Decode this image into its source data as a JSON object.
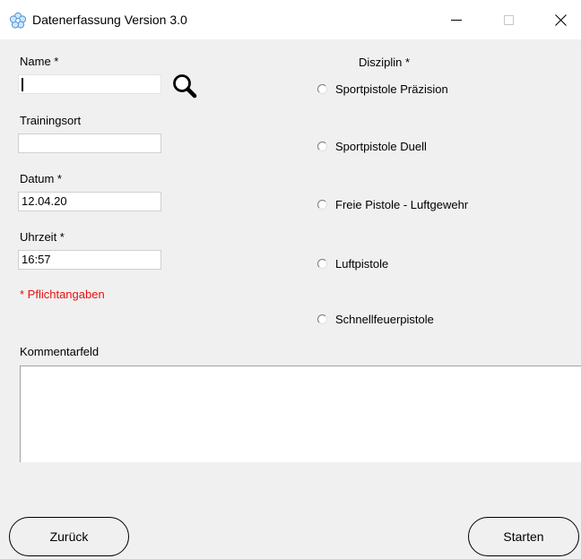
{
  "window": {
    "title": "Datenerfassung Version 3.0",
    "icon": "app-flower-icon",
    "controls": {
      "minimize": "minimize-icon",
      "maximize": "maximize-icon",
      "close": "close-icon"
    }
  },
  "form": {
    "name_label": "Name *",
    "name_value": "",
    "search_icon": "search-icon",
    "trainingsort_label": "Trainingsort",
    "trainingsort_value": "",
    "datum_label": "Datum *",
    "datum_value": "12.04.20",
    "uhrzeit_label": "Uhrzeit *",
    "uhrzeit_value": "16:57",
    "required_note": "* Pflichtangaben"
  },
  "disziplin": {
    "label": "Disziplin *",
    "options": [
      {
        "label": "Sportpistole Präzision",
        "selected": false
      },
      {
        "label": "Sportpistole Duell",
        "selected": false
      },
      {
        "label": "Freie Pistole - Luftgewehr",
        "selected": false
      },
      {
        "label": "Luftpistole",
        "selected": false
      },
      {
        "label": "Schnellfeuerpistole",
        "selected": false
      }
    ]
  },
  "comment": {
    "label": "Kommentarfeld",
    "value": ""
  },
  "buttons": {
    "back_label": "Zurück",
    "start_label": "Starten"
  },
  "colors": {
    "required_note": "#e81010",
    "window_bg": "#f0f0f0"
  }
}
